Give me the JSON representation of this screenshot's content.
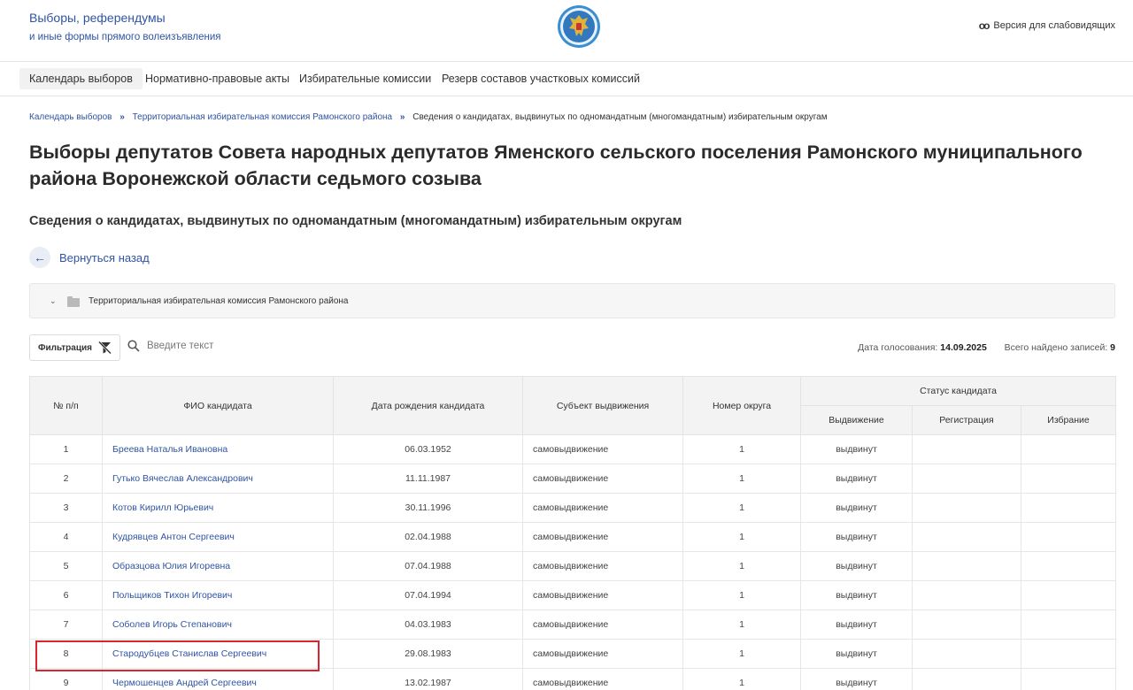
{
  "header": {
    "brand_line1": "Выборы, референдумы",
    "brand_line2": "и иные формы прямого волеизъявления",
    "emblem_icon": "emblem-icon",
    "accessibility_label": "Версия для слабовидящих"
  },
  "nav": {
    "items": [
      "Календарь выборов",
      "Нормативно-правовые акты",
      "Избирательные комиссии",
      "Резерв составов участковых комиссий"
    ]
  },
  "breadcrumb": {
    "items": [
      "Календарь выборов",
      "Территориальная избирательная комиссия Рамонского района",
      "Сведения о кандидатах, выдвинутых по одномандатным (многомандатным) избирательным округам"
    ],
    "separator": "»"
  },
  "page": {
    "title": "Выборы депутатов Совета народных депутатов Яменского сельского поселения Рамонского муниципального района Воронежской области седьмого созыва",
    "subtitle": "Сведения о кандидатах, выдвинутых по одномандатным (многомандатным) избирательным округам",
    "back_label": "Вернуться назад"
  },
  "tree": {
    "label": "Территориальная избирательная комиссия Рамонского района"
  },
  "toolbar": {
    "filter_label": "Фильтрация",
    "search_placeholder": "Введите текст",
    "voting_date_label": "Дата голосования:",
    "voting_date": "14.09.2025",
    "total_label": "Всего найдено записей:",
    "total": "9"
  },
  "table": {
    "headers": {
      "num": "№ п/п",
      "name": "ФИО кандидата",
      "birth": "Дата рождения кандидата",
      "subject": "Субъект выдвижения",
      "district": "Номер округа",
      "status": "Статус кандидата",
      "nomination": "Выдвижение",
      "registration": "Регистрация",
      "election": "Избрание"
    },
    "rows": [
      {
        "num": "1",
        "name": "Бреева Наталья Ивановна",
        "birth": "06.03.1952",
        "subject": "самовыдвижение",
        "district": "1",
        "nomination": "выдвинут",
        "registration": "",
        "election": ""
      },
      {
        "num": "2",
        "name": "Гутько Вячеслав Александрович",
        "birth": "11.11.1987",
        "subject": "самовыдвижение",
        "district": "1",
        "nomination": "выдвинут",
        "registration": "",
        "election": ""
      },
      {
        "num": "3",
        "name": "Котов Кирилл Юрьевич",
        "birth": "30.11.1996",
        "subject": "самовыдвижение",
        "district": "1",
        "nomination": "выдвинут",
        "registration": "",
        "election": ""
      },
      {
        "num": "4",
        "name": "Кудрявцев Антон Сергеевич",
        "birth": "02.04.1988",
        "subject": "самовыдвижение",
        "district": "1",
        "nomination": "выдвинут",
        "registration": "",
        "election": ""
      },
      {
        "num": "5",
        "name": "Образцова Юлия Игоревна",
        "birth": "07.04.1988",
        "subject": "самовыдвижение",
        "district": "1",
        "nomination": "выдвинут",
        "registration": "",
        "election": ""
      },
      {
        "num": "6",
        "name": "Польщиков Тихон Игоревич",
        "birth": "07.04.1994",
        "subject": "самовыдвижение",
        "district": "1",
        "nomination": "выдвинут",
        "registration": "",
        "election": ""
      },
      {
        "num": "7",
        "name": "Соболев Игорь Степанович",
        "birth": "04.03.1983",
        "subject": "самовыдвижение",
        "district": "1",
        "nomination": "выдвинут",
        "registration": "",
        "election": ""
      },
      {
        "num": "8",
        "name": "Стародубцев Станислав Сергеевич",
        "birth": "29.08.1983",
        "subject": "самовыдвижение",
        "district": "1",
        "nomination": "выдвинут",
        "registration": "",
        "election": ""
      },
      {
        "num": "9",
        "name": "Чермошенцев Андрей Сергеевич",
        "birth": "13.02.1987",
        "subject": "самовыдвижение",
        "district": "1",
        "nomination": "выдвинут",
        "registration": "",
        "election": ""
      }
    ]
  },
  "colors": {
    "accent": "#2f54a4",
    "highlight": "#d9262e"
  }
}
